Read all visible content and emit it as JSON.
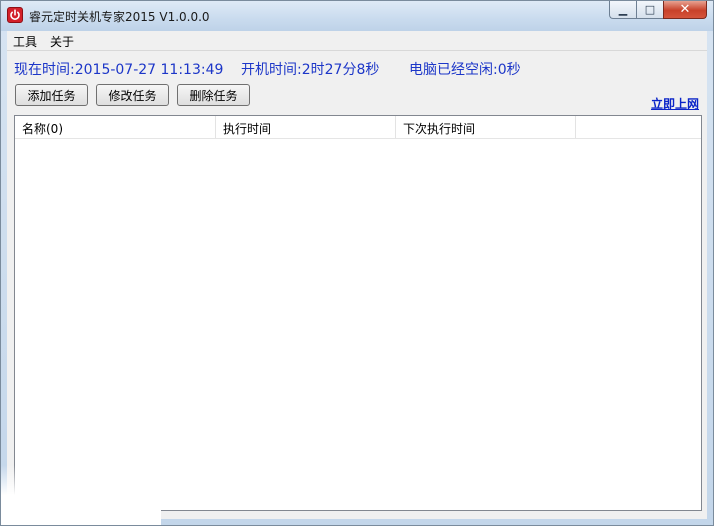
{
  "window": {
    "title": "睿元定时关机专家2015 V1.0.0.0",
    "min_glyph": "▁",
    "max_glyph": "□",
    "close_glyph": "✕"
  },
  "menu": [
    "工具",
    "关于"
  ],
  "status": {
    "current_time": "现在时间:2015-07-27 11:13:49",
    "boot_time": "开机时间:2时27分8秒",
    "idle_time": "电脑已经空闲:0秒"
  },
  "buttons": {
    "add": "添加任务",
    "edit": "修改任务",
    "delete": "删除任务"
  },
  "link": "立即上网",
  "table": {
    "columns": [
      "名称(0)",
      "执行时间",
      "下次执行时间"
    ],
    "rows": []
  },
  "colors": {
    "status_text": "#1c36c8",
    "link": "#0a24c8",
    "app_icon": "#d3202a"
  },
  "icons": {
    "app": "power-icon"
  }
}
